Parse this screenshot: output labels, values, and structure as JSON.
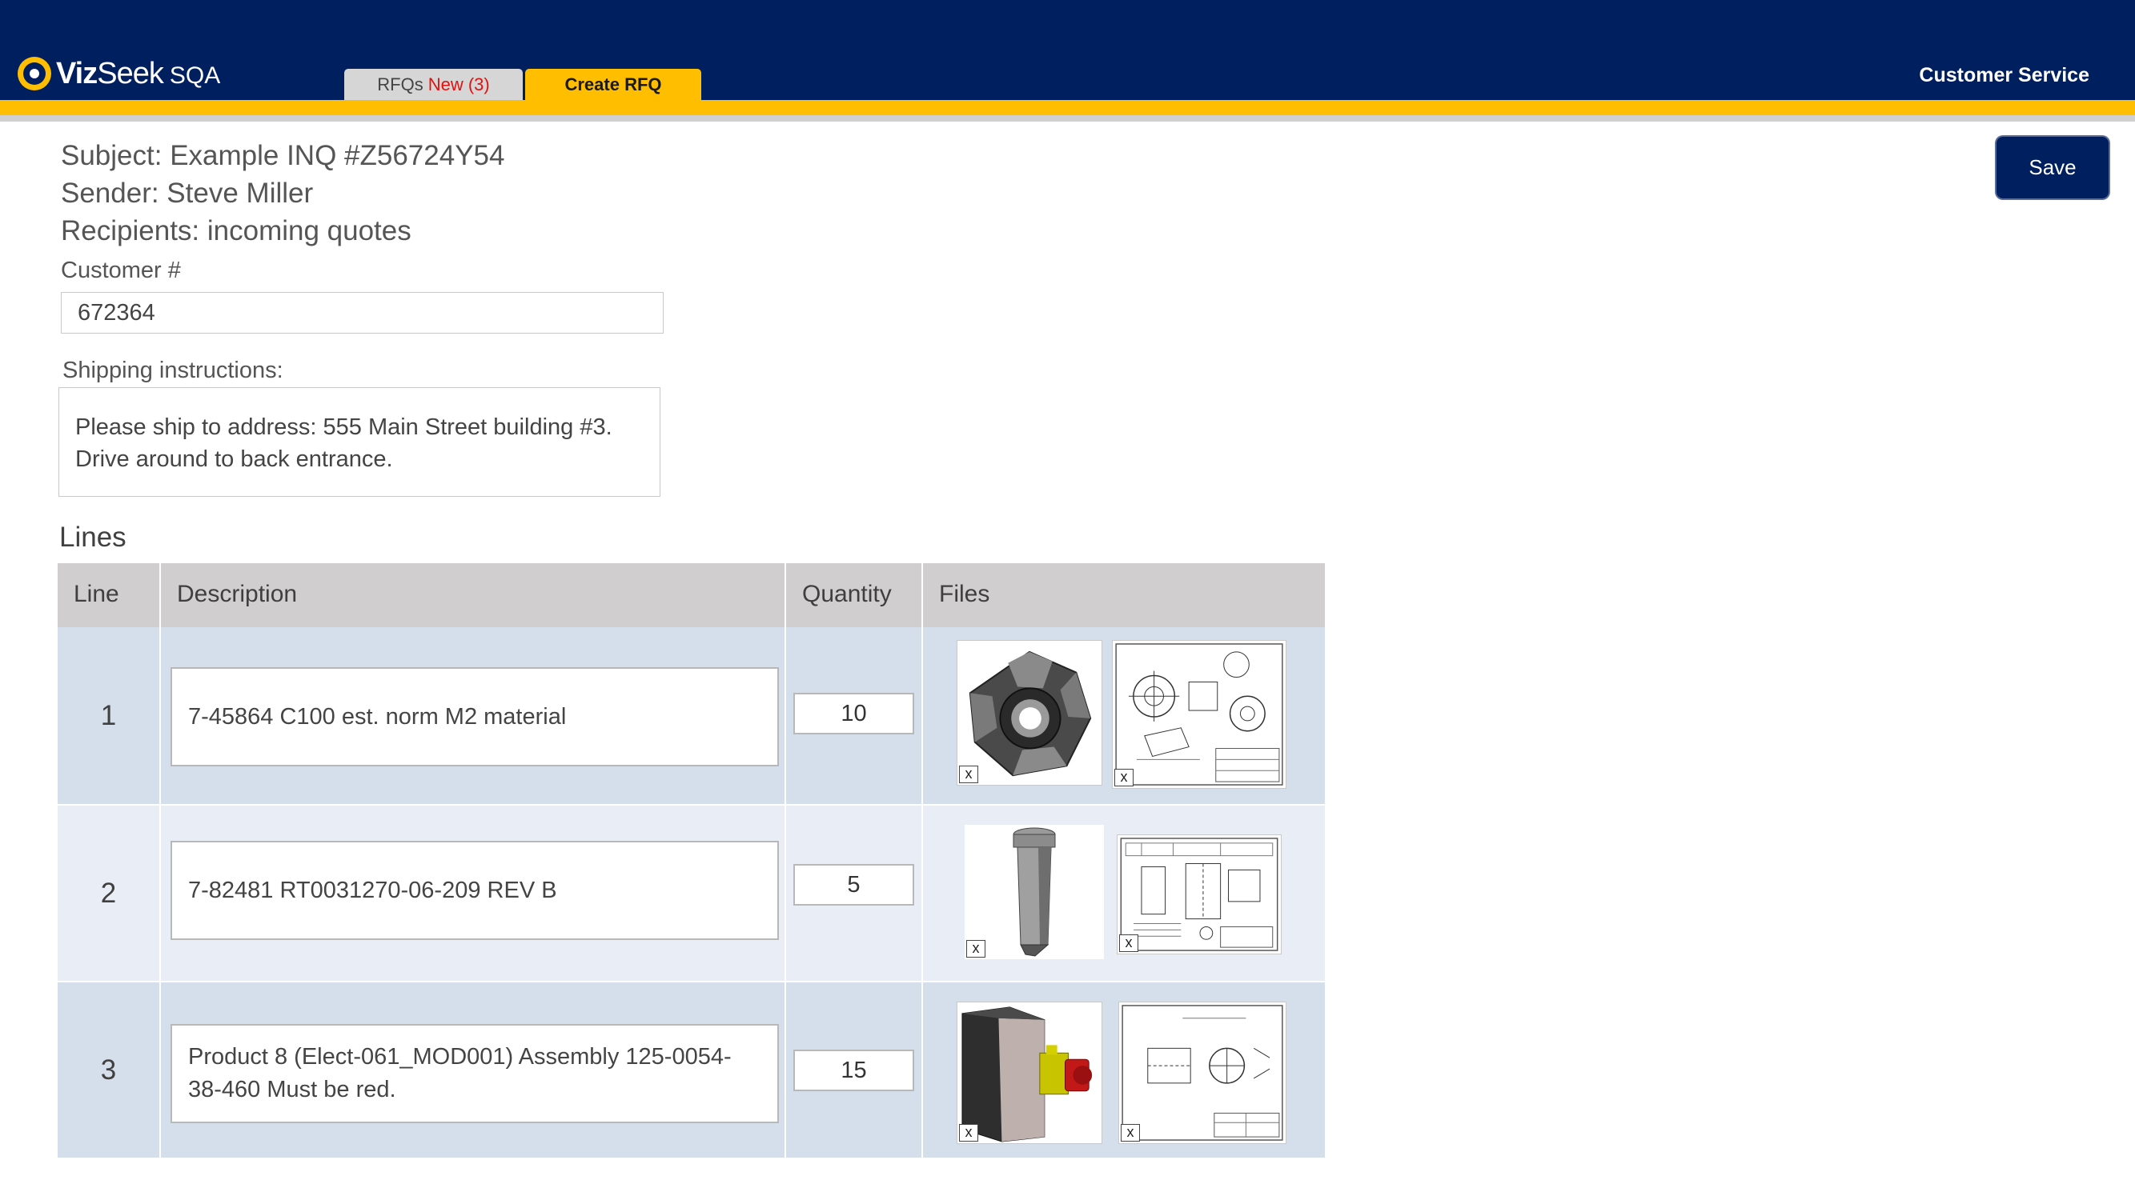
{
  "header": {
    "logo_brand_bold": "Viz",
    "logo_brand_rest": "Seek",
    "logo_suffix": "SQA",
    "tabs": [
      {
        "label": "RFQs",
        "badge": "New (3)"
      },
      {
        "label": "Create RFQ"
      }
    ],
    "customer_service": "Customer Service"
  },
  "info": {
    "subject": "Subject: Example INQ #Z56724Y54",
    "sender": "Sender: Steve Miller",
    "recipients": "Recipients: incoming quotes"
  },
  "customer": {
    "label": "Customer #",
    "value": "672364"
  },
  "shipping": {
    "label": "Shipping instructions:",
    "value": "Please ship to address: 555 Main Street building #3. Drive around to back entrance."
  },
  "save_label": "Save",
  "lines": {
    "title": "Lines",
    "columns": [
      "Line",
      "Description",
      "Quantity",
      "Files"
    ],
    "rows": [
      {
        "line": "1",
        "description": "7-45864 C100 est. norm M2 material",
        "quantity": "10",
        "files": [
          {
            "icon": "3d-model-thumbnail",
            "remove": "x"
          },
          {
            "icon": "drawing-thumbnail",
            "remove": "x"
          }
        ]
      },
      {
        "line": "2",
        "description": "7-82481 RT0031270-06-209 REV B",
        "quantity": "5",
        "files": [
          {
            "icon": "3d-model-thumbnail",
            "remove": "x"
          },
          {
            "icon": "drawing-thumbnail",
            "remove": "x"
          }
        ]
      },
      {
        "line": "3",
        "description": "Product 8 (Elect-061_MOD001) Assembly 125-0054-38-460 Must be red.",
        "quantity": "15",
        "files": [
          {
            "icon": "3d-model-thumbnail",
            "remove": "x"
          },
          {
            "icon": "drawing-thumbnail",
            "remove": "x"
          }
        ]
      }
    ]
  },
  "colors": {
    "navy": "#001f5f",
    "accent_yellow": "#ffbf00",
    "badge_red": "#e01010"
  }
}
